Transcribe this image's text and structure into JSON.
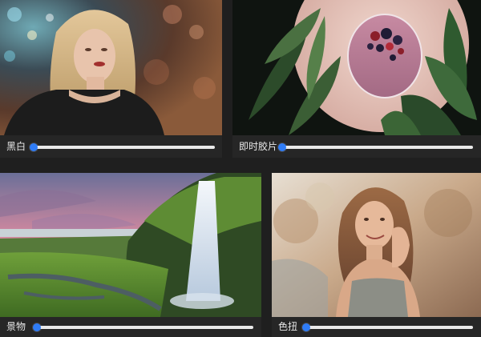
{
  "panels": [
    {
      "label": "黑白",
      "image": "portrait-woman-bokeh-thumbnail",
      "slider_value": 0.0
    },
    {
      "label": "即时胶片",
      "image": "berry-smoothie-leaves-thumbnail",
      "slider_value": 0.0
    },
    {
      "label": "景物",
      "image": "waterfall-landscape-thumbnail",
      "slider_value": 0.0
    },
    {
      "label": "色扭",
      "image": "portrait-woman-field-thumbnail",
      "slider_value": 0.0
    }
  ],
  "colors": {
    "background": "#1f1f1f",
    "slider_track": "#e9e9e9",
    "slider_accent": "#2f7cf6",
    "label_text": "#e8e8e8"
  }
}
